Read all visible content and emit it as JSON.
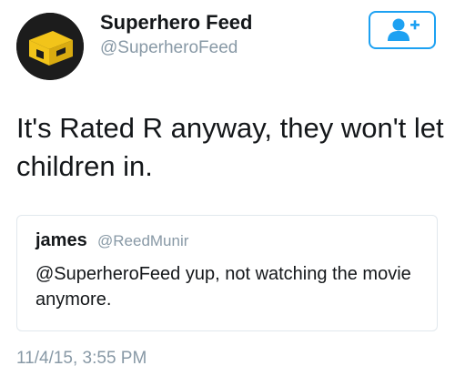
{
  "author": {
    "display_name": "Superhero Feed",
    "handle": "@SuperheroFeed",
    "avatar_icon": "superhero-feed-logo-icon"
  },
  "follow_button": {
    "icon": "follow-user-plus-icon",
    "accent_color": "#1da1f2"
  },
  "tweet": {
    "text": "It's Rated R anyway, they won't let children in.",
    "timestamp": "11/4/15, 3:55 PM"
  },
  "quoted_tweet": {
    "display_name": "james",
    "handle": "@ReedMunir",
    "text": "@SuperheroFeed yup, not watching the movie anymore."
  },
  "colors": {
    "text_primary": "#14171a",
    "text_secondary": "#8899a6",
    "logo_yellow": "#f2c41a",
    "avatar_bg": "#1c1c1c",
    "card_border": "#e1e8ed"
  }
}
